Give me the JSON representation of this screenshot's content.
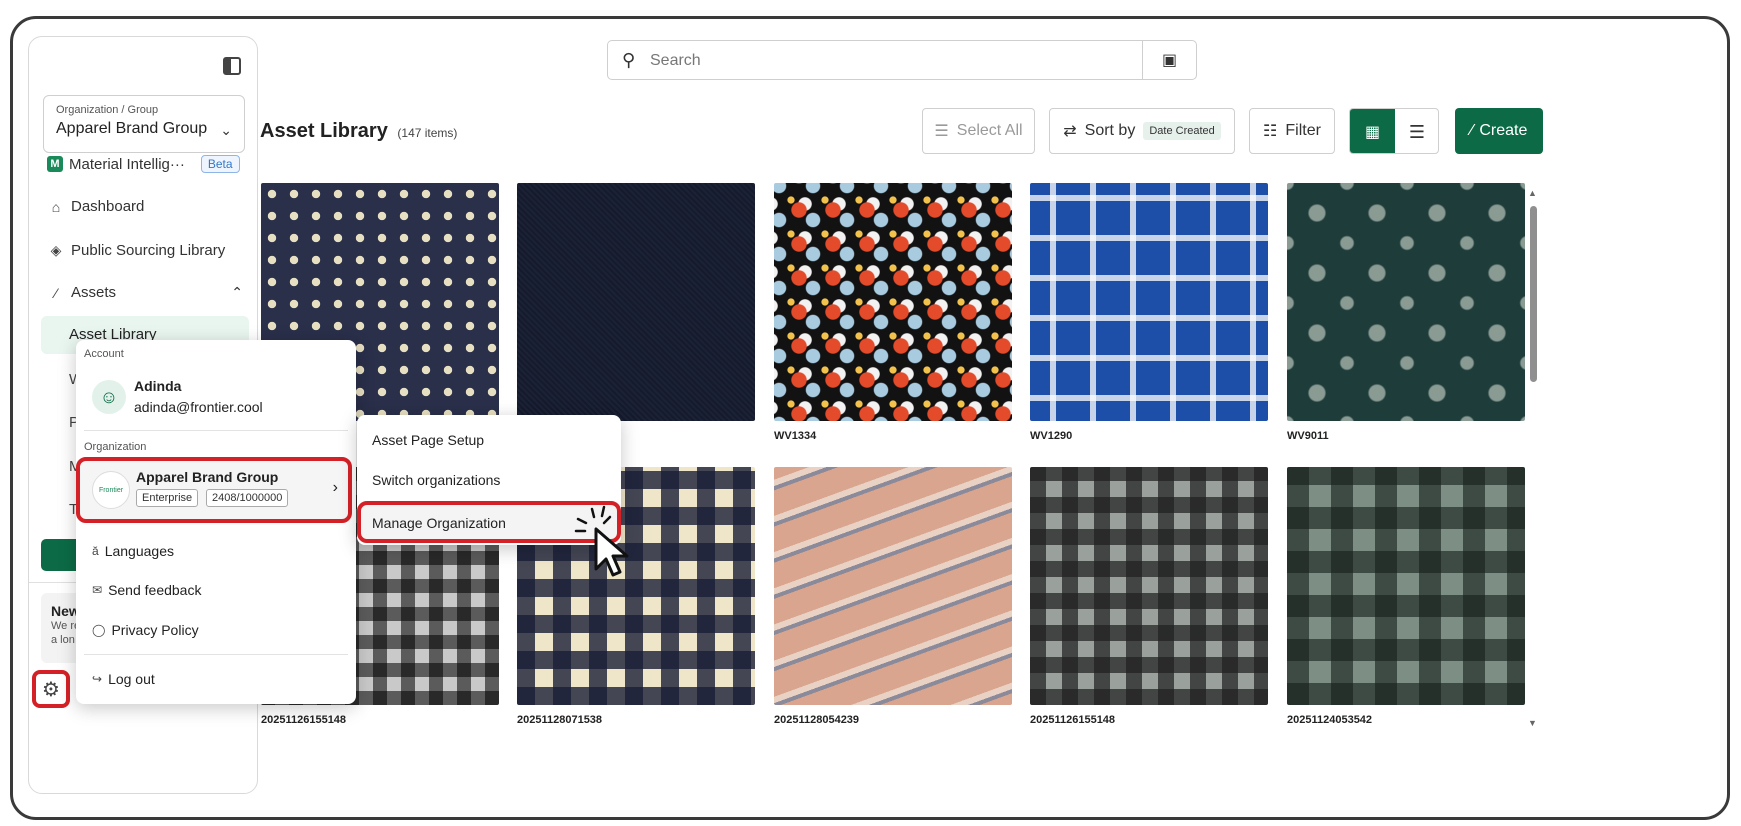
{
  "sidebar": {
    "org_select": {
      "label": "Organization / Group",
      "value": "Apparel Brand Group"
    },
    "items": [
      {
        "label": "Material Intellig···",
        "badge": "Beta",
        "icon": "material-intelligence-logo"
      },
      {
        "label": "Dashboard",
        "icon": "dashboard-icon"
      },
      {
        "label": "Public Sourcing Library",
        "icon": "layers-icon"
      },
      {
        "label": "Assets",
        "icon": "assets-icon"
      }
    ],
    "active_item": "Asset Library",
    "hidden_initials": [
      "W",
      "P",
      "M",
      "T"
    ],
    "news": {
      "title": "New",
      "line1": "We re",
      "line2": "a lon"
    }
  },
  "search": {
    "placeholder": "Search"
  },
  "header": {
    "title": "Asset Library",
    "count": "(147 items)",
    "select_all": "Select All",
    "sort_label": "Sort by",
    "sort_value": "Date Created",
    "filter": "Filter",
    "create": "Create"
  },
  "assets": [
    {
      "label": "",
      "pattern": "navy-geometric"
    },
    {
      "label": "",
      "pattern": "dark-navy"
    },
    {
      "label": "WV1334",
      "pattern": "floral"
    },
    {
      "label": "WV1290",
      "pattern": "blue-plaid"
    },
    {
      "label": "WV9011",
      "pattern": "teal-floral"
    },
    {
      "label": "20251126155148",
      "pattern": "dark-gingham"
    },
    {
      "label": "20251128071538",
      "pattern": "navy-gingham"
    },
    {
      "label": "20251128054239",
      "pattern": "pink-stripe"
    },
    {
      "label": "20251126155148",
      "pattern": "gray-gingham"
    },
    {
      "label": "20251124053542",
      "pattern": "green-plaid"
    }
  ],
  "account_menu": {
    "account_section": "Account",
    "user_name": "Adinda",
    "user_email": "adinda@frontier.cool",
    "org_section": "Organization",
    "org_name": "Apparel Brand Group",
    "org_logo_text": "Frontier",
    "plan": "Enterprise",
    "usage": "2408/1000000",
    "languages": "Languages",
    "feedback": "Send feedback",
    "privacy": "Privacy Policy",
    "logout": "Log out"
  },
  "org_submenu": {
    "items": [
      "Asset Page Setup",
      "Switch organizations",
      "Manage Organization"
    ]
  },
  "colors": {
    "brand_green": "#0c6b46",
    "highlight_red": "#d42127"
  }
}
